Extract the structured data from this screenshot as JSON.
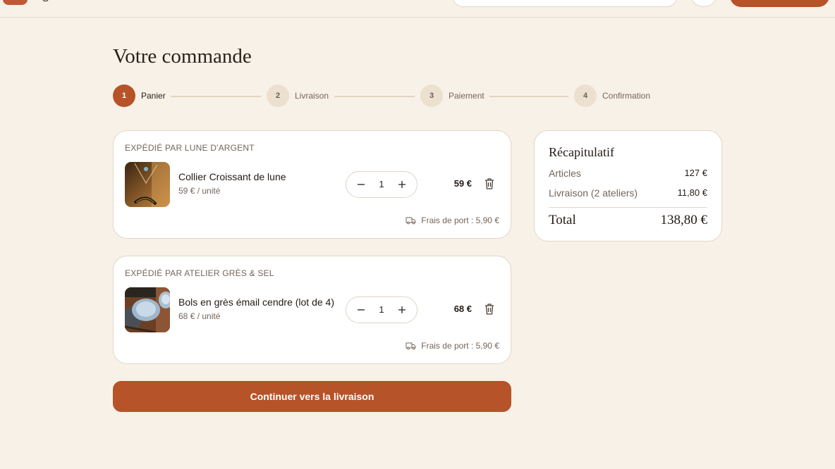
{
  "page": {
    "title": "Votre commande"
  },
  "steps": [
    {
      "number": "1",
      "label": "Panier"
    },
    {
      "number": "2",
      "label": "Livraison"
    },
    {
      "number": "3",
      "label": "Paiement"
    },
    {
      "number": "4",
      "label": "Confirmation"
    }
  ],
  "current_step": 1,
  "orders": [
    {
      "shop": "Expédié par Lune d'Argent",
      "item": {
        "name": "Collier Croissant de lune",
        "unit_price": "59 € / unité",
        "quantity": "1",
        "total": "59 €"
      },
      "shipping": "Frais de port : 5,90 €"
    },
    {
      "shop": "Expédié par Atelier Grès & Sel",
      "item": {
        "name": "Bols en grès émail cendre (lot de 4)",
        "unit_price": "68 € / unité",
        "quantity": "1",
        "total": "68 €"
      },
      "shipping": "Frais de port : 5,90 €"
    }
  ],
  "continue_label": "Continuer vers la livraison",
  "summary": {
    "title": "Récapitulatif",
    "rows": [
      {
        "label": "Articles",
        "value": "127 €"
      },
      {
        "label": "Livraison (2 ateliers)",
        "value": "11,80 €"
      }
    ],
    "total_label": "Total",
    "total_value": "138,80 €"
  },
  "colors": {
    "accent": "#b65328",
    "background": "#f8f1e7",
    "card": "#ffffff",
    "muted_text": "#74655a"
  },
  "icons": {
    "minus": "minus-icon",
    "plus": "plus-icon",
    "delete": "trash-icon",
    "shipping": "truck-icon"
  }
}
